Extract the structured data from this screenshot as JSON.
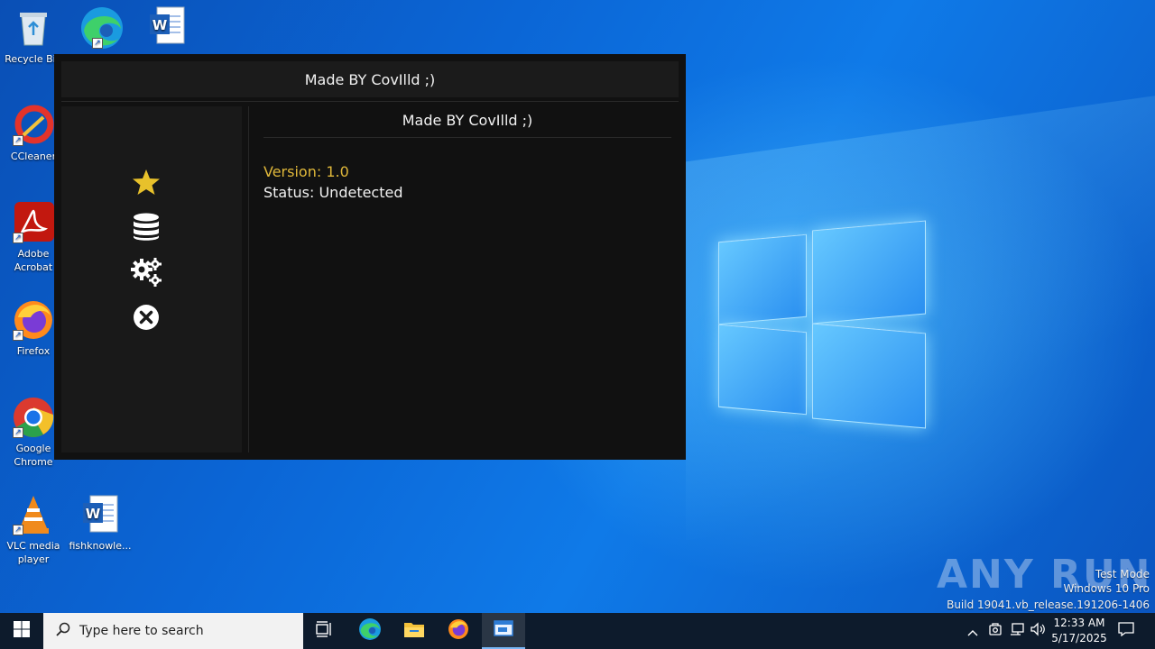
{
  "desktop": {
    "icons": [
      {
        "label": "Recycle Bin",
        "icon": "recycle-bin-icon"
      },
      {
        "label": "",
        "icon": "edge-icon"
      },
      {
        "label": "",
        "icon": "word-doc-icon"
      },
      {
        "label": "CCleaner",
        "icon": "ccleaner-icon"
      },
      {
        "label": "Adobe Acrobat",
        "icon": "acrobat-icon"
      },
      {
        "label": "Firefox",
        "icon": "firefox-icon"
      },
      {
        "label": "Google Chrome",
        "icon": "chrome-icon"
      },
      {
        "label": "VLC media player",
        "icon": "vlc-icon"
      },
      {
        "label": "fishknowle...",
        "icon": "word-doc-icon"
      }
    ]
  },
  "app": {
    "window_title": "Made BY CovIlld ;)",
    "content_title": "Made BY CovIlld ;)",
    "version": "Version: 1.0",
    "status": "Status: Undetected",
    "sidebar_icons": [
      "star-icon",
      "database-icon",
      "gears-icon",
      "close-circle-icon"
    ],
    "colors": {
      "accent": "#e0b83a",
      "background": "#111111",
      "sidebar": "#191919"
    }
  },
  "watermark": {
    "brand": "ANY RUN",
    "line1": "Test Mode",
    "line2": "Windows 10 Pro",
    "line3": "Build 19041.vb_release.191206-1406"
  },
  "taskbar": {
    "search_placeholder": "Type here to search",
    "apps": [
      "task-view-icon",
      "edge-icon",
      "file-explorer-icon",
      "firefox-icon",
      "app-window-icon"
    ],
    "clock_time": "12:33 AM",
    "clock_date": "5/17/2025"
  }
}
